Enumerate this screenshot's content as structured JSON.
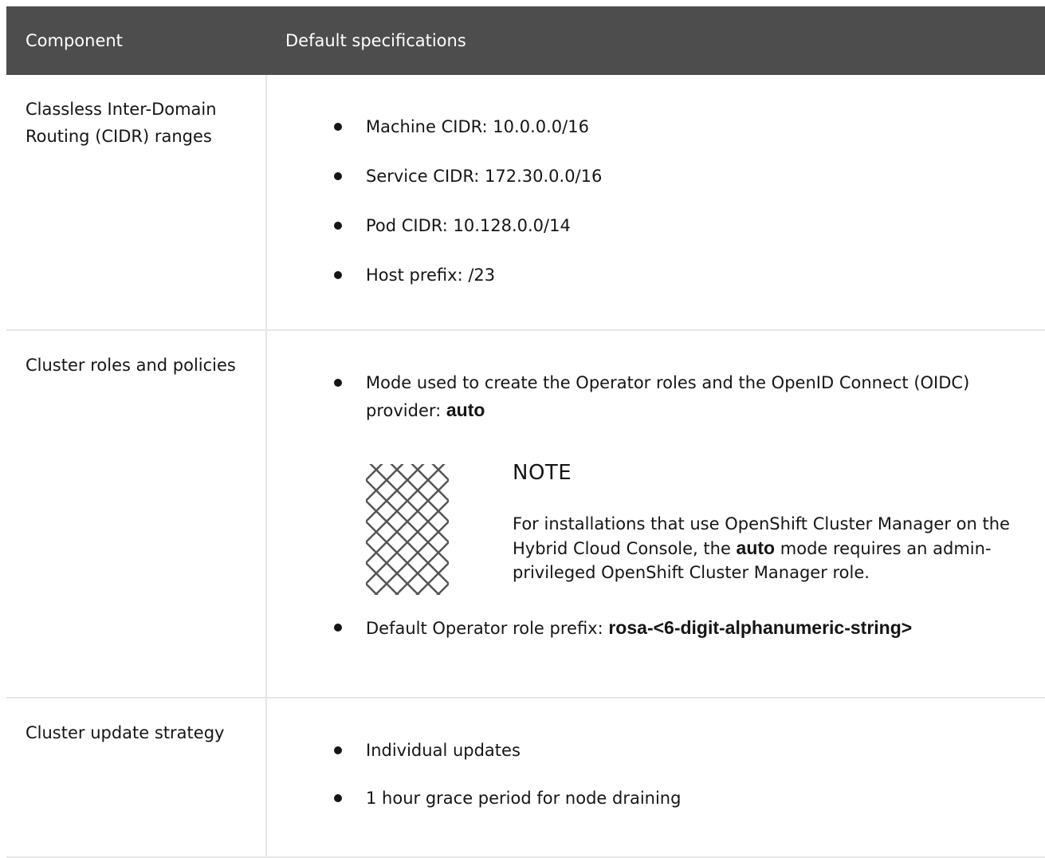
{
  "table": {
    "headers": {
      "component": "Component",
      "specifications": "Default specifications"
    },
    "rows": [
      {
        "component": "Classless Inter-Domain Routing (CIDR) ranges",
        "items": [
          "Machine CIDR: 10.0.0.0/16",
          "Service CIDR: 172.30.0.0/16",
          "Pod CIDR: 10.128.0.0/14",
          "Host prefix: /23"
        ]
      },
      {
        "component": "Cluster roles and policies",
        "item1_text": "Mode used to create the Operator roles and the OpenID Connect (OIDC) provider: ",
        "item1_bold": "auto",
        "note": {
          "icon": "note-icon",
          "title": "NOTE",
          "body_part1": "For installations that use OpenShift Cluster Manager on the Hybrid Cloud Console, the ",
          "body_bold": "auto",
          "body_part2": " mode requires an admin-privileged OpenShift Cluster Manager role."
        },
        "item2_text": "Default Operator role prefix: ",
        "item2_bold": "rosa-<6-digit-alphanumeric-string>"
      },
      {
        "component": "Cluster update strategy",
        "items": [
          "Individual updates",
          "1 hour grace period for node draining"
        ]
      }
    ]
  }
}
